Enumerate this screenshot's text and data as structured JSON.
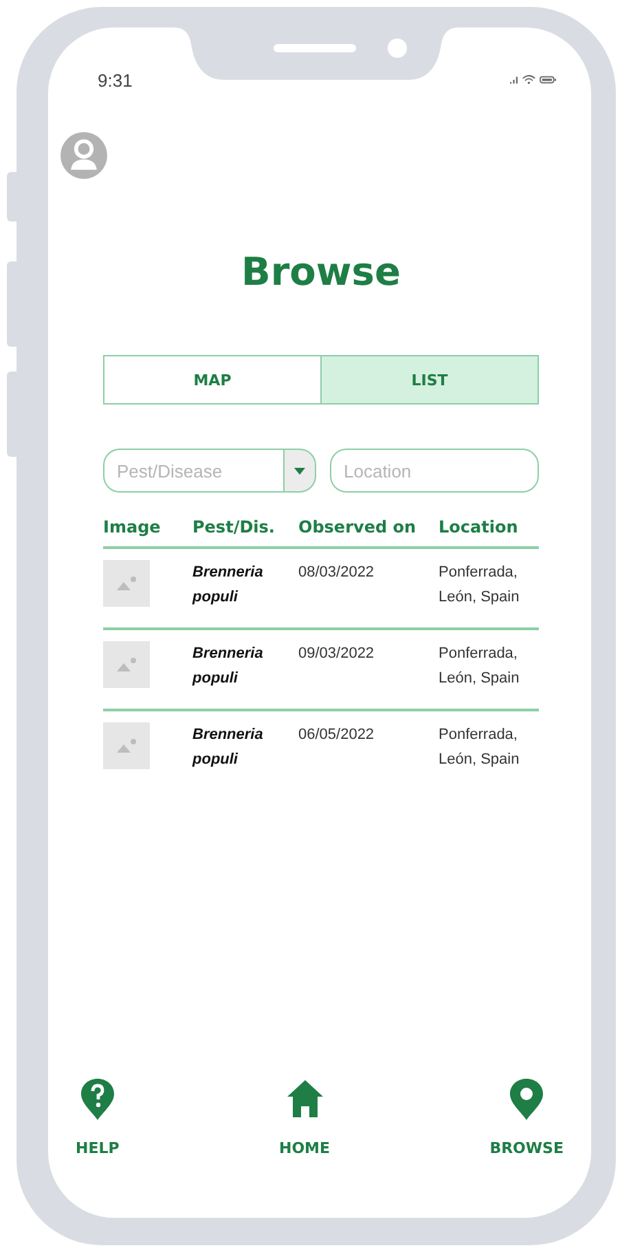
{
  "status_bar": {
    "time": "9:31"
  },
  "title": "Browse",
  "tabs": [
    {
      "label": "MAP",
      "selected": false
    },
    {
      "label": "LIST",
      "selected": true
    }
  ],
  "filters": [
    {
      "kind": "dropdown",
      "placeholder": "Pest/Disease"
    },
    {
      "kind": "text",
      "placeholder": "Location"
    }
  ],
  "table": {
    "columns": [
      "Image",
      "Pest/Dis.",
      "Observed on",
      "Location"
    ],
    "rows": [
      {
        "pest": "Brenneria populi",
        "observed_on": "08/03/2022",
        "location": "Ponferrada, León, Spain"
      },
      {
        "pest": "Brenneria populi",
        "observed_on": "09/03/2022",
        "location": "Ponferrada, León, Spain"
      },
      {
        "pest": "Brenneria populi",
        "observed_on": "06/05/2022",
        "location": "Ponferrada, León, Spain"
      }
    ]
  },
  "nav": [
    {
      "kind": "help",
      "label": "HELP"
    },
    {
      "kind": "home",
      "label": "HOME"
    },
    {
      "kind": "pin",
      "label": "BROWSE"
    }
  ]
}
